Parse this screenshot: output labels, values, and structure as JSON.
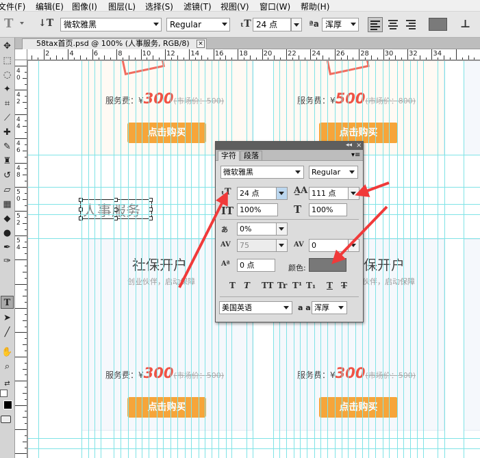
{
  "menubar": {
    "items": [
      "文件(F)",
      "编辑(E)",
      "图像(I)",
      "图层(L)",
      "选择(S)",
      "滤镜(T)",
      "视图(V)",
      "窗口(W)",
      "帮助(H)"
    ]
  },
  "options_bar": {
    "font_family": "微软雅黑",
    "font_style": "Regular",
    "font_size": "24 点",
    "antialias": "浑厚",
    "color": "#7a7a7a"
  },
  "document_tab": {
    "title": "58tax首页.psd @ 100% (人事服务, RGB/8)",
    "close": "×"
  },
  "ruler": {
    "h_labels": [
      "2",
      "4",
      "6",
      "8",
      "10",
      "12",
      "14",
      "16",
      "18",
      "20",
      "22",
      "24",
      "26",
      "28",
      "30",
      "32",
      "34"
    ],
    "v_labels": [
      "4",
      "0",
      "4",
      "2",
      "4",
      "4",
      "4",
      "6",
      "4",
      "8",
      "5",
      "0",
      "5",
      "2",
      "5",
      "4"
    ]
  },
  "canvas": {
    "text_layer": "人事服务",
    "cards_top": [
      {
        "fee_label": "服务费：¥",
        "price": "300",
        "market": "(市场价：500)",
        "button": "点击购买"
      },
      {
        "fee_label": "服务费：¥",
        "price": "500",
        "market": "(市场价：800)",
        "button": "点击购买"
      }
    ],
    "cards_bottom": [
      {
        "title": "社保开户",
        "subtitle": "创业伙伴，启动保障",
        "fee_label": "服务费：¥",
        "price": "300",
        "market": "(市场价：500)",
        "button": "点击购买"
      },
      {
        "title": "保开户",
        "subtitle": "伙伴，启动保障",
        "fee_label": "服务费：¥",
        "price": "300",
        "market": "(市场价：500)",
        "button": "点击购买"
      }
    ]
  },
  "character_panel": {
    "tabs": [
      "字符",
      "段落"
    ],
    "font_family": "微软雅黑",
    "font_style": "Regular",
    "font_size": "24 点",
    "leading": "111 点",
    "vertical_scale": "100%",
    "horizontal_scale": "100%",
    "tsume": "0%",
    "kerning": "75",
    "tracking": "0",
    "baseline_shift": "0 点",
    "color_label": "颜色:",
    "color": "#787878",
    "style_buttons": [
      "T",
      "T",
      "TT",
      "Tr",
      "T¹",
      "T₁",
      "T",
      "T"
    ],
    "language": "美国英语",
    "antialias_icon": "a a",
    "antialias": "浑厚"
  },
  "annotation": {
    "arrow_color": "#f03a3a"
  }
}
